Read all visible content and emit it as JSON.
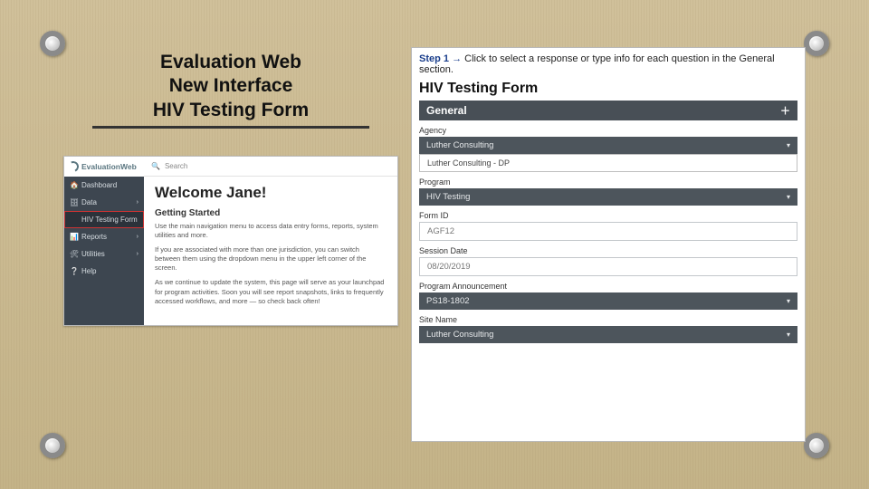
{
  "title": {
    "line1": "Evaluation Web",
    "line2": "New Interface",
    "line3": "HIV Testing Form"
  },
  "left_app": {
    "brand": "EvaluationWeb",
    "search_placeholder": "Search",
    "nav": [
      {
        "icon": "🏠",
        "label": "Dashboard"
      },
      {
        "icon": "🗄",
        "label": "Data"
      },
      {
        "icon": "",
        "label": "HIV Testing Form"
      },
      {
        "icon": "📊",
        "label": "Reports"
      },
      {
        "icon": "🛠",
        "label": "Utilities"
      },
      {
        "icon": "❔",
        "label": "Help"
      }
    ],
    "welcome_heading": "Welcome Jane!",
    "getting_started": "Getting Started",
    "p1": "Use the main navigation menu to access data entry forms, reports, system utilities and more.",
    "p2": "If you are associated with more than one jurisdiction, you can switch between them using the dropdown menu in the upper left corner of the screen.",
    "p3": "As we continue to update the system, this page will serve as your launchpad for program activities. Soon you will see report snapshots, links to frequently accessed workflows, and more — so check back often!"
  },
  "right_panel": {
    "step_label": "Step 1",
    "step_arrow": "→",
    "step_text": "Click to select a response or type info for each question in the General section.",
    "form_title": "HIV Testing Form",
    "section": "General",
    "fields": {
      "agency_label": "Agency",
      "agency_selected": "Luther Consulting",
      "agency_option2": "Luther Consulting - DP",
      "program_label": "Program",
      "program_value": "HIV Testing",
      "form_id_label": "Form ID",
      "form_id_value": "AGF12",
      "session_date_label": "Session Date",
      "session_date_value": "08/20/2019",
      "program_announcement_label": "Program Announcement",
      "program_announcement_value": "PS18-1802",
      "site_name_label": "Site Name",
      "site_name_value": "Luther Consulting"
    }
  }
}
